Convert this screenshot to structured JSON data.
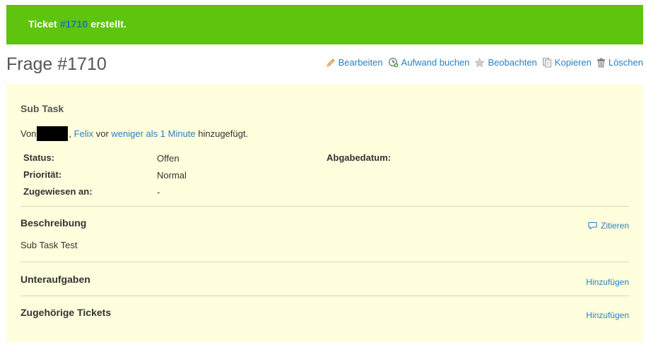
{
  "flash": {
    "prefix": "Ticket ",
    "ticket_link": "#1710",
    "suffix": " erstellt.",
    "color": "#5ec40e"
  },
  "header": {
    "title": "Frage #1710",
    "actions": [
      {
        "label": "Bearbeiten",
        "icon": "pencil-icon"
      },
      {
        "label": "Aufwand buchen",
        "icon": "time-add-icon"
      },
      {
        "label": "Beobachten",
        "icon": "star-icon"
      },
      {
        "label": "Kopieren",
        "icon": "copy-icon"
      },
      {
        "label": "Löschen",
        "icon": "trash-icon"
      }
    ]
  },
  "issue": {
    "subject": "Sub Task",
    "author_prefix": "Von",
    "author_sep": ", ",
    "author_name": "Felix",
    "author_mid": " vor ",
    "time_link": "weniger als 1 Minute",
    "author_suffix": " hinzugefügt.",
    "attributes": {
      "status_label": "Status:",
      "status_value": "Offen",
      "priority_label": "Priorität:",
      "priority_value": "Normal",
      "assignee_label": "Zugewiesen an:",
      "assignee_value": "-",
      "due_label": "Abgabedatum:"
    },
    "description": {
      "heading": "Beschreibung",
      "quote_label": "Zitieren",
      "text": "Sub Task Test"
    },
    "subtasks": {
      "heading": "Unteraufgaben",
      "add_label": "Hinzufügen"
    },
    "relations": {
      "heading": "Zugehörige Tickets",
      "add_label": "Hinzufügen"
    },
    "background": "#ffffdd"
  },
  "colors": {
    "link": "#2a7fc4",
    "flash_green": "#5ec40e"
  }
}
